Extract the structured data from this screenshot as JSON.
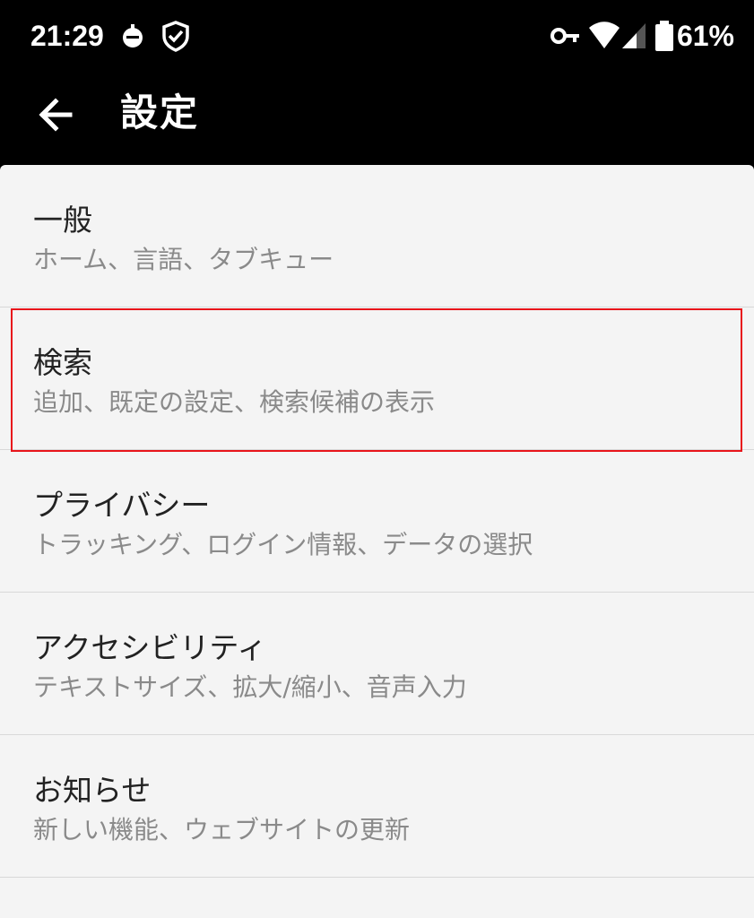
{
  "status_bar": {
    "time": "21:29",
    "battery_percent": "61%",
    "icons": [
      "notification-app-icon",
      "shield-check-icon",
      "vpn-key-icon",
      "wifi-icon",
      "cellular-signal-icon",
      "battery-icon"
    ],
    "battery_level": 0.61
  },
  "app_bar": {
    "title": "設定",
    "back_icon": "arrow-back-icon"
  },
  "settings": {
    "items": [
      {
        "title": "一般",
        "subtitle": "ホーム、言語、タブキュー"
      },
      {
        "title": "検索",
        "subtitle": "追加、既定の設定、検索候補の表示"
      },
      {
        "title": "プライバシー",
        "subtitle": "トラッキング、ログイン情報、データの選択"
      },
      {
        "title": "アクセシビリティ",
        "subtitle": "テキストサイズ、拡大/縮小、音声入力"
      },
      {
        "title": "お知らせ",
        "subtitle": "新しい機能、ウェブサイトの更新"
      }
    ]
  },
  "colors": {
    "bar_background": "#000000",
    "list_background": "#f4f4f4",
    "title_text": "#222222",
    "subtitle_text": "#8a8a8a",
    "highlight": "#e8151b"
  }
}
